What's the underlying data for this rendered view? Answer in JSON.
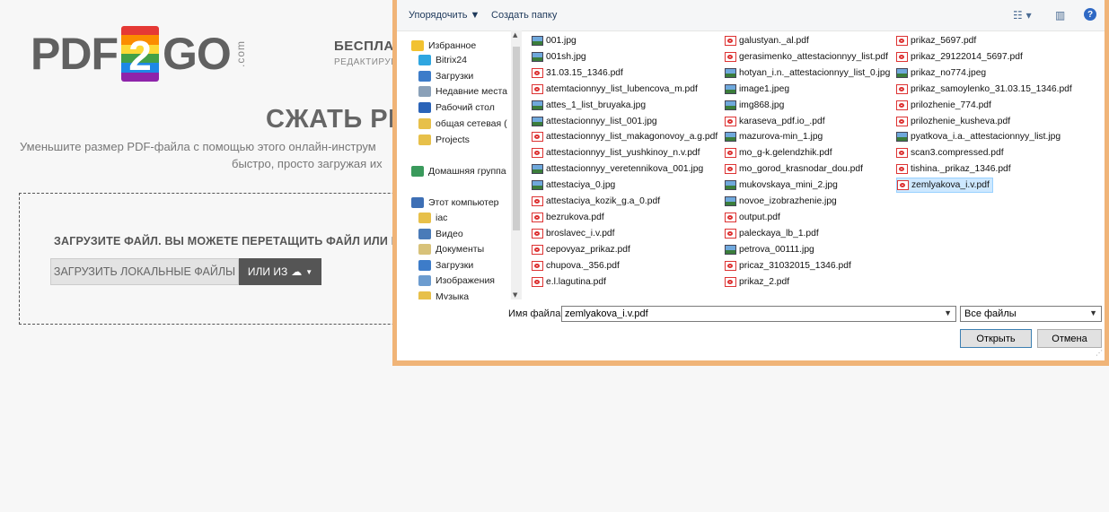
{
  "site": {
    "logo_left": "PDF",
    "logo_num": "2",
    "logo_right": "GO",
    "logo_com": ".com",
    "tagline": "БЕСПЛАТН",
    "tagline2": "РЕДАКТИРУЙТЕ,",
    "heading": "СЖАТЬ PI",
    "subtitle_line1": "Уменьшите размер PDF-файла с помощью этого онлайн-инструм",
    "subtitle_line2": "быстро, просто загружая их",
    "dropzone_text": "ЗАГРУЗИТЕ ФАЙЛ. ВЫ МОЖЕТЕ ПЕРЕТАЩИТЬ ФАЙЛ ИЛИ В",
    "upload_local": "ЗАГРУЗИТЬ ЛОКАЛЬНЫЕ ФАЙЛЫ",
    "upload_from": "ИЛИ ИЗ"
  },
  "dialog": {
    "toolbar": {
      "organize": "Упорядочить ▼",
      "new_folder": "Создать папку",
      "view_icon": "view-options-icon",
      "pane_icon": "preview-pane-icon",
      "help": "?"
    },
    "nav": [
      {
        "label": "Избранное",
        "icon": "star-icon",
        "color": "#f2c230"
      },
      {
        "label": "Bitrix24",
        "icon": "bitrix-icon",
        "color": "#2fa6e0"
      },
      {
        "label": "Загрузки",
        "icon": "downloads-icon",
        "color": "#3d7cc9"
      },
      {
        "label": "Недавние места",
        "icon": "recent-places-icon",
        "color": "#8aa0b8"
      },
      {
        "label": "Рабочий стол",
        "icon": "desktop-icon",
        "color": "#2a63b8"
      },
      {
        "label": "общая сетевая (",
        "icon": "network-folder-icon",
        "color": "#e7c04a"
      },
      {
        "label": "Projects",
        "icon": "folder-icon",
        "color": "#e7c04a"
      },
      {
        "label": "Домашняя группа",
        "icon": "homegroup-icon",
        "color": "#3a9a5c"
      },
      {
        "label": "Этот компьютер",
        "icon": "computer-icon",
        "color": "#3d6fb5"
      },
      {
        "label": "iac",
        "icon": "folder-icon",
        "color": "#e7c04a"
      },
      {
        "label": "Видео",
        "icon": "video-folder-icon",
        "color": "#4a7bb8"
      },
      {
        "label": "Документы",
        "icon": "documents-folder-icon",
        "color": "#d8c27a"
      },
      {
        "label": "Загрузки",
        "icon": "downloads-icon",
        "color": "#3d7cc9"
      },
      {
        "label": "Изображения",
        "icon": "pictures-folder-icon",
        "color": "#6c9ccf"
      },
      {
        "label": "Музыка",
        "icon": "music-folder-icon",
        "color": "#e7c04a"
      }
    ],
    "files_col1": [
      {
        "name": "001.jpg",
        "type": "jpg"
      },
      {
        "name": "001sh.jpg",
        "type": "jpg"
      },
      {
        "name": "31.03.15_1346.pdf",
        "type": "pdf"
      },
      {
        "name": "atemtacionnyy_list_lubencova_m.pdf",
        "type": "pdf"
      },
      {
        "name": "attes_1_list_bruyaka.jpg",
        "type": "jpg"
      },
      {
        "name": "attestacionnyy_list_001.jpg",
        "type": "jpg"
      },
      {
        "name": "attestacionnyy_list_makagonovoy_a.g.pdf",
        "type": "pdf"
      },
      {
        "name": "attestacionnyy_list_yushkinoy_n.v.pdf",
        "type": "pdf"
      },
      {
        "name": "attestacionnyy_veretennikova_001.jpg",
        "type": "jpg"
      },
      {
        "name": "attestaciya_0.jpg",
        "type": "jpg"
      },
      {
        "name": "attestaciya_kozik_g.a_0.pdf",
        "type": "pdf"
      },
      {
        "name": "bezrukova.pdf",
        "type": "pdf"
      },
      {
        "name": "broslavec_i.v.pdf",
        "type": "pdf"
      },
      {
        "name": "cepovyaz_prikaz.pdf",
        "type": "pdf"
      },
      {
        "name": "chupova._356.pdf",
        "type": "pdf"
      },
      {
        "name": "e.l.lagutina.pdf",
        "type": "pdf"
      }
    ],
    "files_col2": [
      {
        "name": "galustyan._al.pdf",
        "type": "pdf"
      },
      {
        "name": "gerasimenko_attestacionnyy_list.pdf",
        "type": "pdf"
      },
      {
        "name": "hotyan_i.n._attestacionnyy_list_0.jpg",
        "type": "jpg"
      },
      {
        "name": "image1.jpeg",
        "type": "jpg"
      },
      {
        "name": "img868.jpg",
        "type": "jpg"
      },
      {
        "name": "karaseva_pdf.io_.pdf",
        "type": "pdf"
      },
      {
        "name": "mazurova-min_1.jpg",
        "type": "jpg"
      },
      {
        "name": "mo_g-k.gelendzhik.pdf",
        "type": "pdf"
      },
      {
        "name": "mo_gorod_krasnodar_dou.pdf",
        "type": "pdf"
      },
      {
        "name": "mukovskaya_mini_2.jpg",
        "type": "jpg"
      },
      {
        "name": "novoe_izobrazhenie.jpg",
        "type": "jpg"
      },
      {
        "name": "output.pdf",
        "type": "pdf"
      },
      {
        "name": "paleckaya_lb_1.pdf",
        "type": "pdf"
      },
      {
        "name": "petrova_00111.jpg",
        "type": "jpg"
      },
      {
        "name": "pricaz_31032015_1346.pdf",
        "type": "pdf"
      },
      {
        "name": "prikaz_2.pdf",
        "type": "pdf"
      }
    ],
    "files_col3": [
      {
        "name": "prikaz_5697.pdf",
        "type": "pdf"
      },
      {
        "name": "prikaz_29122014_5697.pdf",
        "type": "pdf"
      },
      {
        "name": "prikaz_no774.jpeg",
        "type": "jpg"
      },
      {
        "name": "prikaz_samoylenko_31.03.15_1346.pdf",
        "type": "pdf"
      },
      {
        "name": "prilozhenie_774.pdf",
        "type": "pdf"
      },
      {
        "name": "prilozhenie_kusheva.pdf",
        "type": "pdf"
      },
      {
        "name": "pyatkova_i.a._attestacionnyy_list.jpg",
        "type": "jpg"
      },
      {
        "name": "scan3.compressed.pdf",
        "type": "pdf"
      },
      {
        "name": "tishina._prikaz_1346.pdf",
        "type": "pdf"
      },
      {
        "name": "zemlyakova_i.v.pdf",
        "type": "pdf",
        "selected": true
      }
    ],
    "filename_label": "Имя файла:",
    "filename_value": "zemlyakova_i.v.pdf",
    "filter_value": "Все файлы",
    "open_button": "Открыть",
    "cancel_button": "Отмена"
  }
}
